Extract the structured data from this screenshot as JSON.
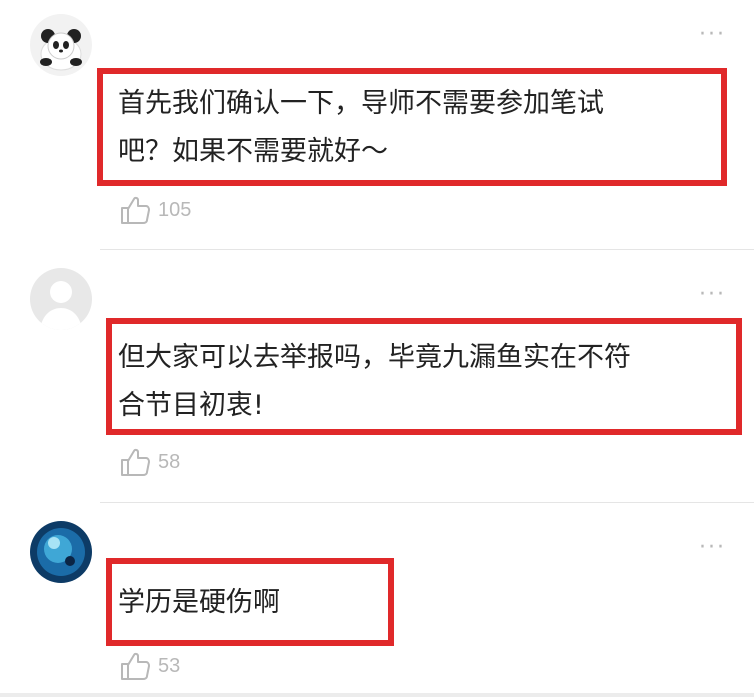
{
  "comments": [
    {
      "text": "首先我们确认一下，导师不需要参加笔试\n吧？如果不需要就好～",
      "likes": "105",
      "more": "···"
    },
    {
      "text": "但大家可以去举报吗，毕竟九漏鱼实在不符\n合节目初衷!",
      "likes": "58",
      "more": "···"
    },
    {
      "text": "学历是硬伤啊",
      "likes": "53",
      "more": "···"
    }
  ],
  "colors": {
    "highlight_border": "#e0292a",
    "meta_gray": "#b8b8b8",
    "divider": "#e5e5e5"
  },
  "icons": {
    "like": "thumbs-up-outline-icon",
    "more": "more-dots-icon"
  }
}
